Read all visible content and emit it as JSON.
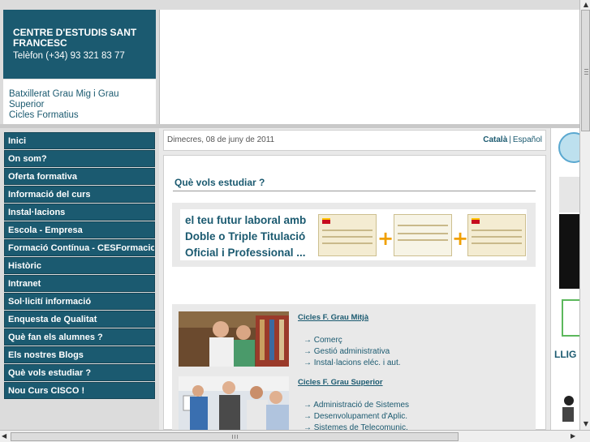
{
  "header": {
    "title": "CENTRE D'ESTUDIS SANT FRANCESC",
    "phone": "Telèfon (+34) 93 321 83 77",
    "subtitle_line1": "Batxillerat Grau Mig i Grau Superior",
    "subtitle_line2": "Cicles Formatius"
  },
  "menu": [
    {
      "label": "Inici"
    },
    {
      "label": "On som?"
    },
    {
      "label": "Oferta formativa"
    },
    {
      "label": "Informació del curs"
    },
    {
      "label": "Instal·lacions"
    },
    {
      "label": "Escola - Empresa"
    },
    {
      "label": "Formació Contínua - CESFormacio"
    },
    {
      "label": "Històric"
    },
    {
      "label": "Intranet"
    },
    {
      "label": "Sol·licití informació"
    },
    {
      "label": "Enquesta de Qualitat"
    },
    {
      "label": "Què fan els alumnes ?"
    },
    {
      "label": "Els nostres Blogs"
    },
    {
      "label": "Què vols estudiar ?"
    },
    {
      "label": "Nou Curs CISCO !"
    }
  ],
  "date_bar": {
    "date": "Dimecres, 08 de juny de 2011",
    "lang_ca": "Català",
    "lang_sep": "|",
    "lang_es": "Español"
  },
  "main": {
    "heading": "Què vols estudiar ?",
    "promo_line1": "el teu futur laboral amb",
    "promo_line2": "Doble o Triple Titulació",
    "promo_line3": "Oficial i Professional ...",
    "courses": [
      {
        "title": "Cicles F. Grau Mitjà",
        "items": [
          "→ Comerç",
          "→ Gestió administrativa",
          "→ Instal·lacions eléc. i aut."
        ]
      },
      {
        "title": "Cicles F. Grau Superior",
        "items": [
          "→ Administració de Sistemes",
          "→ Desenvolupament d'Aplic.",
          "→ Sistemes de Telecomunic."
        ]
      }
    ]
  },
  "right_col": {
    "partial_text": "LLIG"
  },
  "colors": {
    "brand": "#1b5a70",
    "accent": "#f0a000"
  }
}
